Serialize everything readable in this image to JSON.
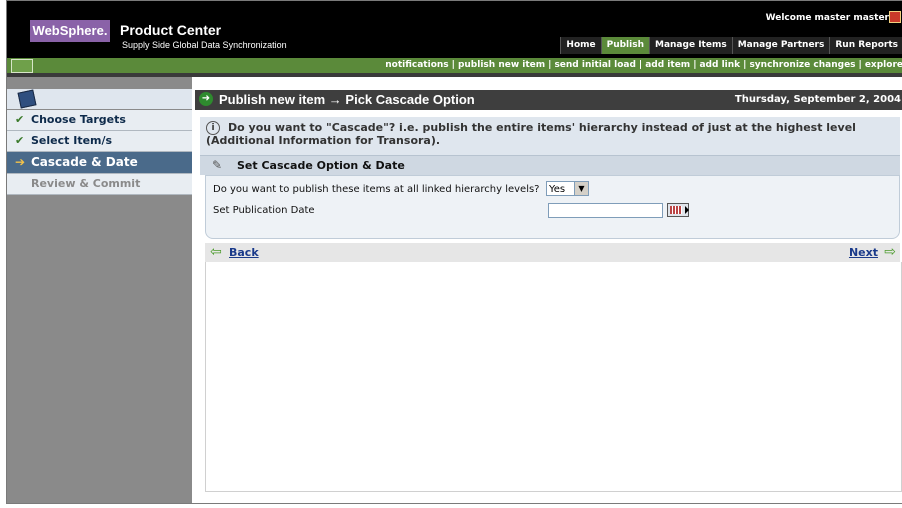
{
  "brand": {
    "logo": "WebSphere.",
    "product": "Product Center",
    "subtitle": "Supply Side Global Data Synchronization"
  },
  "user": {
    "welcome": "Welcome   master master"
  },
  "tabs": [
    {
      "label": "Home"
    },
    {
      "label": "Publish",
      "active": true
    },
    {
      "label": "Manage Items"
    },
    {
      "label": "Manage Partners"
    },
    {
      "label": "Run Reports"
    }
  ],
  "actions": [
    "notifications",
    "publish new item",
    "send initial load",
    "add item",
    "add link",
    "synchronize changes",
    "explore"
  ],
  "sidebar": {
    "items": [
      {
        "label": "Choose Targets",
        "state": "done"
      },
      {
        "label": "Select Item/s",
        "state": "done"
      },
      {
        "label": "Cascade & Date",
        "state": "active"
      },
      {
        "label": "Review & Commit",
        "state": "disabled"
      }
    ]
  },
  "page": {
    "title": "Publish new item → Pick Cascade Option",
    "date": "Thursday, September 2, 2004"
  },
  "info": {
    "text": "Do you want to \"Cascade\"? i.e. publish the entire items' hierarchy instead of just at the highest level (Additional Information for Transora)."
  },
  "section": {
    "title": "Set Cascade Option & Date"
  },
  "form": {
    "cascade_label": "Do you want to publish these items at all linked hierarchy levels?",
    "cascade_value": "Yes",
    "date_label": "Set Publication Date",
    "date_value": ""
  },
  "nav": {
    "back": "Back",
    "next": "Next"
  }
}
